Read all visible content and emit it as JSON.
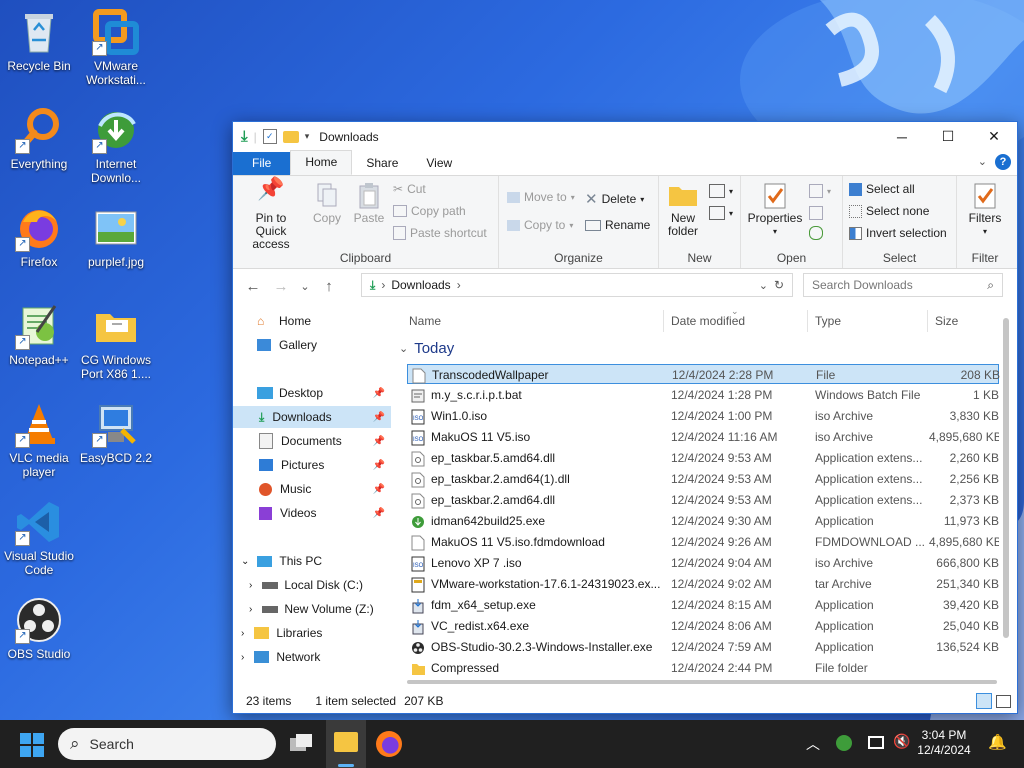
{
  "desktop": {
    "icons": [
      {
        "label": "Recycle Bin"
      },
      {
        "label": "VMware Workstati..."
      },
      {
        "label": "Everything"
      },
      {
        "label": "Internet Downlo..."
      },
      {
        "label": "Firefox"
      },
      {
        "label": "purplef.jpg"
      },
      {
        "label": "Notepad++"
      },
      {
        "label": "CG Windows Port X86 1...."
      },
      {
        "label": "VLC media player"
      },
      {
        "label": "EasyBCD 2.2"
      },
      {
        "label": "Visual Studio Code"
      },
      {
        "label": "OBS Studio"
      }
    ]
  },
  "window": {
    "title": "Downloads",
    "controls": {
      "minimize": "─",
      "maximize": "☐",
      "close": "✕"
    }
  },
  "ribbon": {
    "tabs": [
      {
        "label": "File"
      },
      {
        "label": "Home"
      },
      {
        "label": "Share"
      },
      {
        "label": "View"
      }
    ],
    "clipboard": {
      "group": "Clipboard",
      "pin": "Pin to Quick access",
      "copy": "Copy",
      "paste": "Paste",
      "cut": "Cut",
      "copy_path": "Copy path",
      "paste_shortcut": "Paste shortcut"
    },
    "organize": {
      "group": "Organize",
      "move_to": "Move to",
      "copy_to": "Copy to",
      "delete": "Delete",
      "rename": "Rename"
    },
    "new": {
      "group": "New",
      "new_folder": "New folder"
    },
    "open": {
      "group": "Open",
      "properties": "Properties"
    },
    "select": {
      "group": "Select",
      "select_all": "Select all",
      "select_none": "Select none",
      "invert": "Invert selection"
    },
    "filter": {
      "group": "Filter",
      "filters": "Filters"
    }
  },
  "address": {
    "path": "Downloads",
    "search_placeholder": "Search Downloads"
  },
  "navpane": {
    "items": [
      {
        "label": "Home"
      },
      {
        "label": "Gallery"
      },
      {
        "label": "Desktop"
      },
      {
        "label": "Downloads"
      },
      {
        "label": "Documents"
      },
      {
        "label": "Pictures"
      },
      {
        "label": "Music"
      },
      {
        "label": "Videos"
      },
      {
        "label": "This PC"
      },
      {
        "label": "Local Disk (C:)"
      },
      {
        "label": "New Volume (Z:)"
      },
      {
        "label": "Libraries"
      },
      {
        "label": "Network"
      }
    ]
  },
  "columns": {
    "name": "Name",
    "date": "Date modified",
    "type": "Type",
    "size": "Size"
  },
  "group_label": "Today",
  "files": [
    {
      "name": "TranscodedWallpaper",
      "date": "12/4/2024 2:28 PM",
      "type": "File",
      "size": "208 KB",
      "icon": "blank-file"
    },
    {
      "name": "m.y_s.c.r.i.p.t.bat",
      "date": "12/4/2024 1:28 PM",
      "type": "Windows Batch File",
      "size": "1 KB",
      "icon": "batch"
    },
    {
      "name": "Win1.0.iso",
      "date": "12/4/2024 1:00 PM",
      "type": "iso Archive",
      "size": "3,830 KB",
      "icon": "iso"
    },
    {
      "name": "MakuOS 11 V5.iso",
      "date": "12/4/2024 11:16 AM",
      "type": "iso Archive",
      "size": "4,895,680 KB",
      "icon": "iso"
    },
    {
      "name": "ep_taskbar.5.amd64.dll",
      "date": "12/4/2024 9:53 AM",
      "type": "Application extens...",
      "size": "2,260 KB",
      "icon": "dll"
    },
    {
      "name": "ep_taskbar.2.amd64(1).dll",
      "date": "12/4/2024 9:53 AM",
      "type": "Application extens...",
      "size": "2,256 KB",
      "icon": "dll"
    },
    {
      "name": "ep_taskbar.2.amd64.dll",
      "date": "12/4/2024 9:53 AM",
      "type": "Application extens...",
      "size": "2,373 KB",
      "icon": "dll"
    },
    {
      "name": "idman642build25.exe",
      "date": "12/4/2024 9:30 AM",
      "type": "Application",
      "size": "11,973 KB",
      "icon": "idm"
    },
    {
      "name": "MakuOS 11 V5.iso.fdmdownload",
      "date": "12/4/2024 9:26 AM",
      "type": "FDMDOWNLOAD ...",
      "size": "4,895,680 KB",
      "icon": "blank-file"
    },
    {
      "name": "Lenovo XP 7 .iso",
      "date": "12/4/2024 9:04 AM",
      "type": "iso Archive",
      "size": "666,800 KB",
      "icon": "iso"
    },
    {
      "name": "VMware-workstation-17.6.1-24319023.ex...",
      "date": "12/4/2024 9:02 AM",
      "type": "tar Archive",
      "size": "251,340 KB",
      "icon": "tar"
    },
    {
      "name": "fdm_x64_setup.exe",
      "date": "12/4/2024 8:15 AM",
      "type": "Application",
      "size": "39,420 KB",
      "icon": "installer"
    },
    {
      "name": "VC_redist.x64.exe",
      "date": "12/4/2024 8:06 AM",
      "type": "Application",
      "size": "25,040 KB",
      "icon": "installer"
    },
    {
      "name": "OBS-Studio-30.2.3-Windows-Installer.exe",
      "date": "12/4/2024 7:59 AM",
      "type": "Application",
      "size": "136,524 KB",
      "icon": "obs"
    },
    {
      "name": "Compressed",
      "date": "12/4/2024 2:44 PM",
      "type": "File folder",
      "size": "",
      "icon": "folder"
    }
  ],
  "status": {
    "count": "23 items",
    "selected": "1 item selected",
    "size": "207 KB"
  },
  "taskbar": {
    "search": "Search",
    "time": "3:04 PM",
    "date": "12/4/2024"
  },
  "colors": {
    "accent": "#1a6fd1",
    "selection": "#cce4f7",
    "taskbar": "#202020"
  }
}
